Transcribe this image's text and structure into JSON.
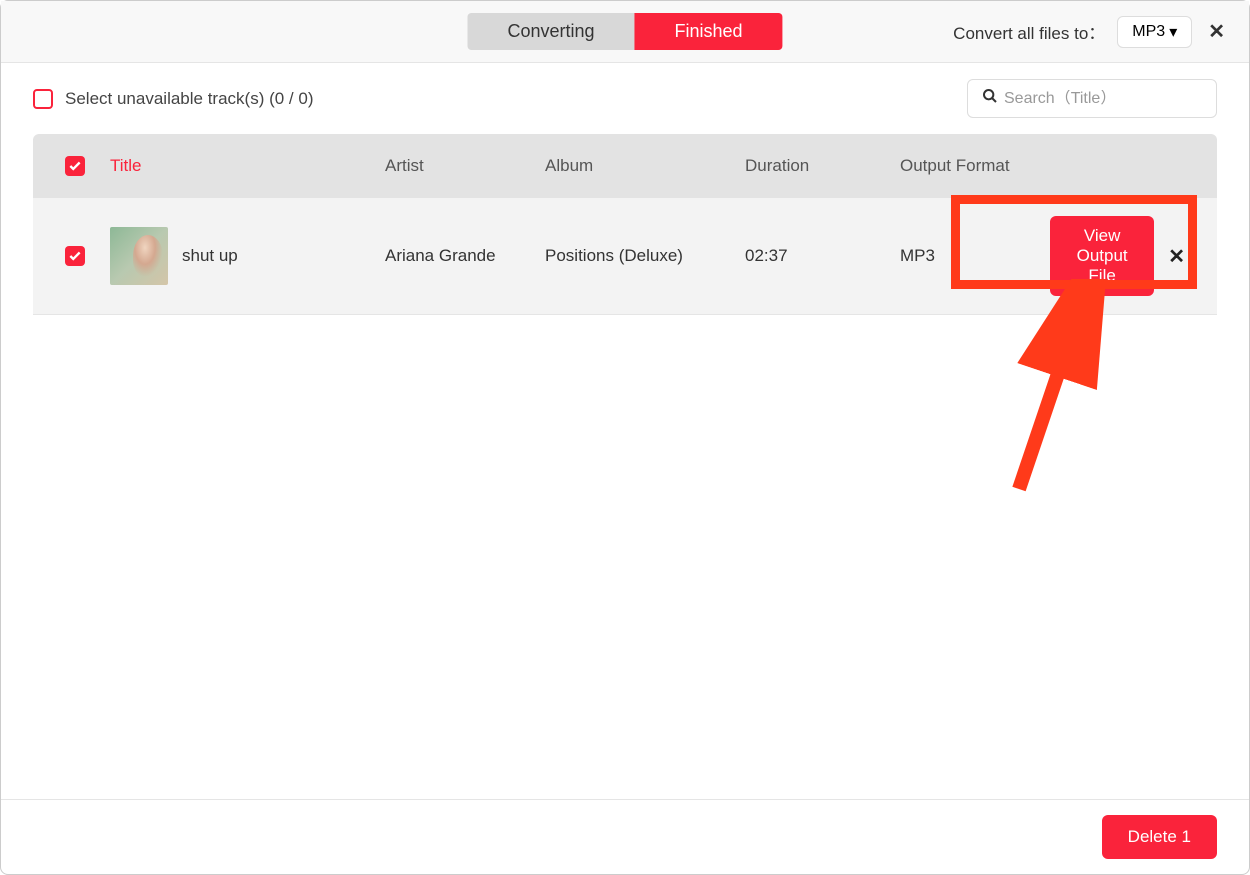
{
  "header": {
    "tabs": {
      "converting": "Converting",
      "finished": "Finished"
    },
    "convert_label": "Convert all files to：",
    "format_value": "MP3"
  },
  "toolbar": {
    "select_label": "Select unavailable track(s) (0 / 0)",
    "search_placeholder": "Search（Title）"
  },
  "table": {
    "columns": {
      "title": "Title",
      "artist": "Artist",
      "album": "Album",
      "duration": "Duration",
      "format": "Output Format"
    },
    "rows": [
      {
        "title": "shut up",
        "artist": "Ariana Grande",
        "album": "Positions (Deluxe)",
        "duration": "02:37",
        "format": "MP3",
        "action_label": "View Output File"
      }
    ]
  },
  "footer": {
    "delete_label": "Delete 1"
  }
}
